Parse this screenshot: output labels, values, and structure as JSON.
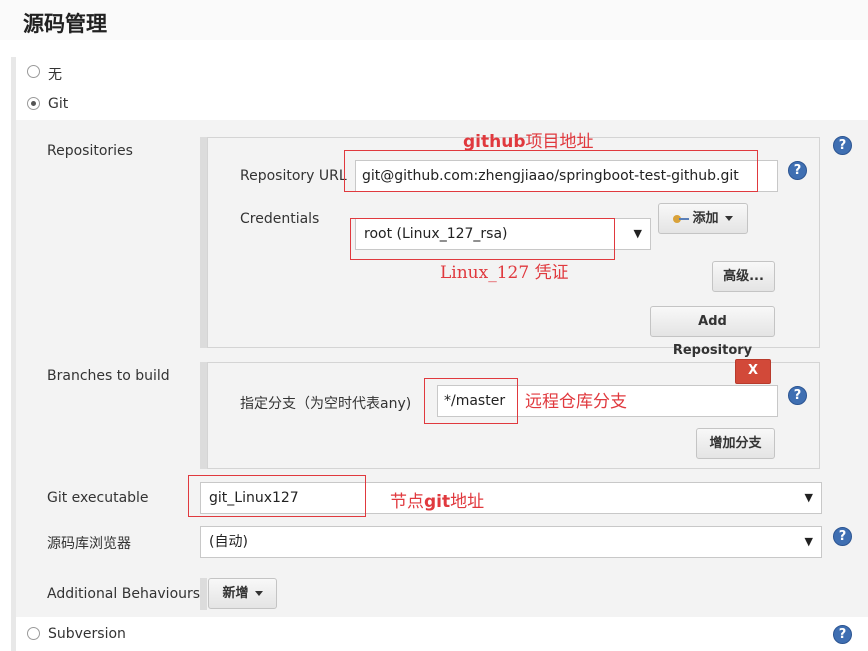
{
  "section_title": "源码管理",
  "scm_options": {
    "none_label": "无",
    "git_label": "Git",
    "subversion_label": "Subversion"
  },
  "repositories": {
    "label": "Repositories",
    "url_label": "Repository URL",
    "url_value": "git@github.com:zhengjiaao/springboot-test-github.git",
    "credentials_label": "Credentials",
    "credentials_value": "root (Linux_127_rsa)",
    "add_button": "添加",
    "advanced_button": "高级...",
    "add_repository_button": "Add Repository"
  },
  "branches": {
    "label": "Branches to build",
    "spec_label": "指定分支（为空时代表any)",
    "spec_value": "*/master",
    "delete_button": "X",
    "add_branch_button": "增加分支"
  },
  "git_executable": {
    "label": "Git executable",
    "value": "git_Linux127"
  },
  "repo_browser": {
    "label": "源码库浏览器",
    "value": "(自动)"
  },
  "additional_behaviours": {
    "label": "Additional Behaviours",
    "add_button": "新增"
  },
  "help_icon_text": "?",
  "annotations": {
    "github_address_bold": "github",
    "github_address_rest": "项目地址",
    "credential_note": "Linux_127 凭证",
    "branch_note": "远程仓库分支",
    "node_git_prefix": "节点",
    "node_git_bold": "git",
    "node_git_suffix": "地址"
  },
  "colors": {
    "annotation": "#e0393e",
    "help_icon": "#3f6fb2",
    "delete_button": "#d24939"
  }
}
